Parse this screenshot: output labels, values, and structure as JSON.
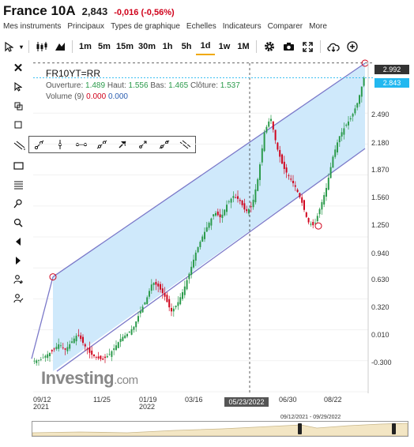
{
  "header": {
    "title": "France 10A",
    "price": "2,843",
    "change": "-0,016 (-0,56%)"
  },
  "menu": [
    "Mes instruments",
    "Principaux",
    "Types de graphique",
    "Echelles",
    "Indicateurs",
    "Comparer",
    "More"
  ],
  "toolbar": {
    "timeframes": [
      "1m",
      "5m",
      "15m",
      "30m",
      "1h",
      "5h",
      "1d",
      "1w",
      "1M"
    ],
    "selected_timeframe": "1d"
  },
  "legend": {
    "symbol": "FR10YT=RR",
    "open_label": "Ouverture:",
    "open": "1.489",
    "high_label": "Haut:",
    "high": "1.556",
    "low_label": "Bas:",
    "low": "1.465",
    "close_label": "Clôture:",
    "close": "1.537",
    "volume_label": "Volume (9)",
    "volume_a": "0.000",
    "volume_b": "0.000"
  },
  "badges": {
    "top": "2.992",
    "last": "2.843",
    "cursor_date": "05/23/2022"
  },
  "watermark": {
    "brand": "Investing",
    "suffix": ".com"
  },
  "navigator": {
    "range": "09/12/2021 - 09/29/2022"
  },
  "colors": {
    "up": "#2a9a4a",
    "down": "#d0021b",
    "channel_fill": "#cfe9fb",
    "channel_line": "#7b79c9",
    "last_badge": "#22b8f0"
  },
  "chart_data": {
    "type": "candlestick",
    "y_ticks": [
      "2.490",
      "2.180",
      "1.870",
      "1.560",
      "1.250",
      "0.940",
      "0.630",
      "0.320",
      "0.010",
      "-0.300"
    ],
    "x_ticks": [
      {
        "label": "09/12",
        "sub": "2021"
      },
      {
        "label": "11/25",
        "sub": ""
      },
      {
        "label": "01/19",
        "sub": "2022"
      },
      {
        "label": "03/16",
        "sub": ""
      },
      {
        "label": "06/30",
        "sub": ""
      },
      {
        "label": "08/22",
        "sub": ""
      }
    ],
    "ylim": [
      -0.3,
      2.99
    ],
    "series": [
      {
        "values": [
          0.01,
          0.02,
          0.07,
          0.11,
          0.18,
          0.12,
          0.2,
          0.28,
          0.17,
          0.08,
          0.04,
          0.02,
          0.07,
          0.15,
          0.24,
          0.28,
          0.35,
          0.5,
          0.62,
          0.8,
          0.75,
          0.65,
          0.5,
          0.58,
          0.72,
          0.9,
          1.1,
          1.25,
          1.38,
          1.5,
          1.44,
          1.58,
          1.66,
          1.62,
          1.5,
          1.56,
          1.85,
          2.3,
          2.45,
          2.15,
          1.95,
          1.85,
          1.75,
          1.6,
          1.4,
          1.36,
          1.55,
          1.75,
          2.05,
          2.25,
          2.36,
          2.45,
          2.6,
          2.843
        ]
      }
    ]
  }
}
